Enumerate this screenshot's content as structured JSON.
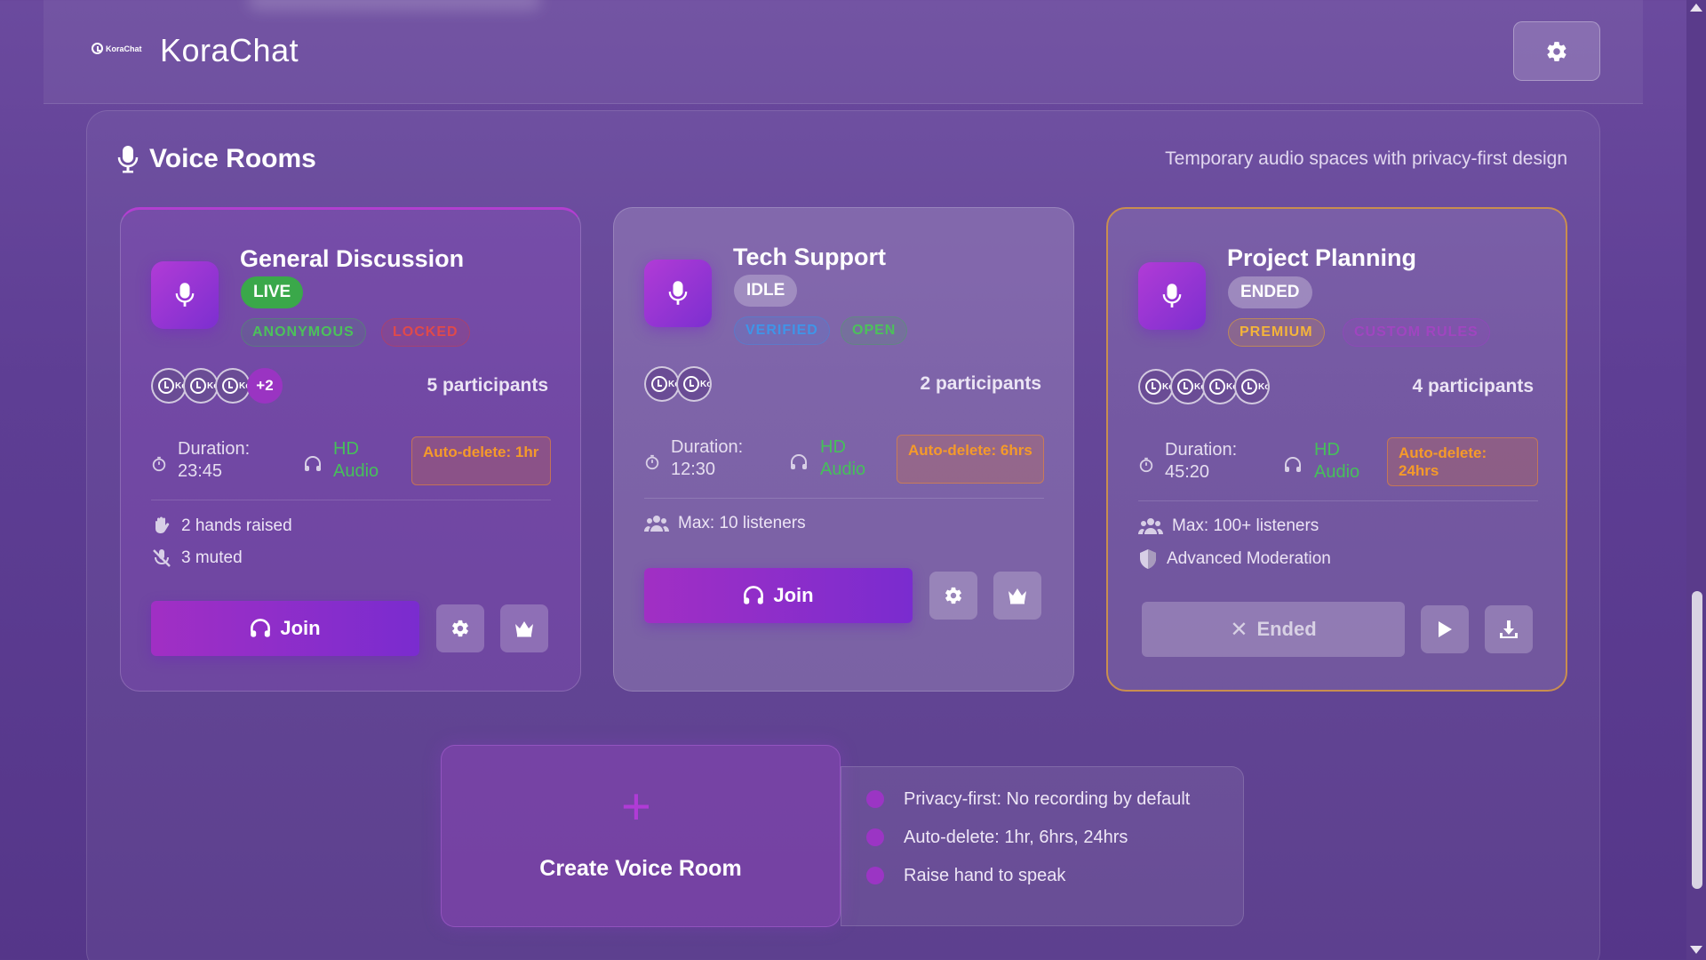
{
  "app": {
    "logo_text": "KoraChat",
    "title": "KoraChat"
  },
  "section": {
    "title": "Voice Rooms",
    "subtitle": "Temporary audio spaces with privacy-first design"
  },
  "rooms": [
    {
      "name": "General Discussion",
      "status": "LIVE",
      "tags": [
        "ANONYMOUS",
        "LOCKED"
      ],
      "avatar_initial": "Ko",
      "avatar_more": "+2",
      "participants": "5 participants",
      "duration_label": "Duration:",
      "duration": "23:45",
      "audio": "HD Audio",
      "auto_delete": "Auto-delete: 1hr",
      "features": [
        "2 hands raised",
        "3 muted"
      ],
      "action": "Join"
    },
    {
      "name": "Tech Support",
      "status": "IDLE",
      "tags": [
        "VERIFIED",
        "OPEN"
      ],
      "avatar_initial": "Ko",
      "participants": "2 participants",
      "duration_label": "Duration:",
      "duration": "12:30",
      "audio": "HD Audio",
      "auto_delete": "Auto-delete: 6hrs",
      "features": [
        "Max: 10 listeners"
      ],
      "action": "Join"
    },
    {
      "name": "Project Planning",
      "status": "ENDED",
      "tags": [
        "PREMIUM",
        "CUSTOM RULES"
      ],
      "avatar_initial": "Ko",
      "participants": "4 participants",
      "duration_label": "Duration:",
      "duration": "45:20",
      "audio": "HD Audio",
      "auto_delete": "Auto-delete: 24hrs",
      "features": [
        "Max: 100+ listeners",
        "Advanced Moderation"
      ],
      "action": "Ended"
    }
  ],
  "create": {
    "plus": "+",
    "label": "Create Voice Room"
  },
  "privacy_info": [
    "Privacy-first: No recording by default",
    "Auto-delete: 1hr, 6hrs, 24hrs",
    "Raise hand to speak"
  ],
  "colors": {
    "accent": "#a12fc4",
    "live": "#3aa84a",
    "warning": "#f59a2a",
    "audio": "#46c05a"
  }
}
